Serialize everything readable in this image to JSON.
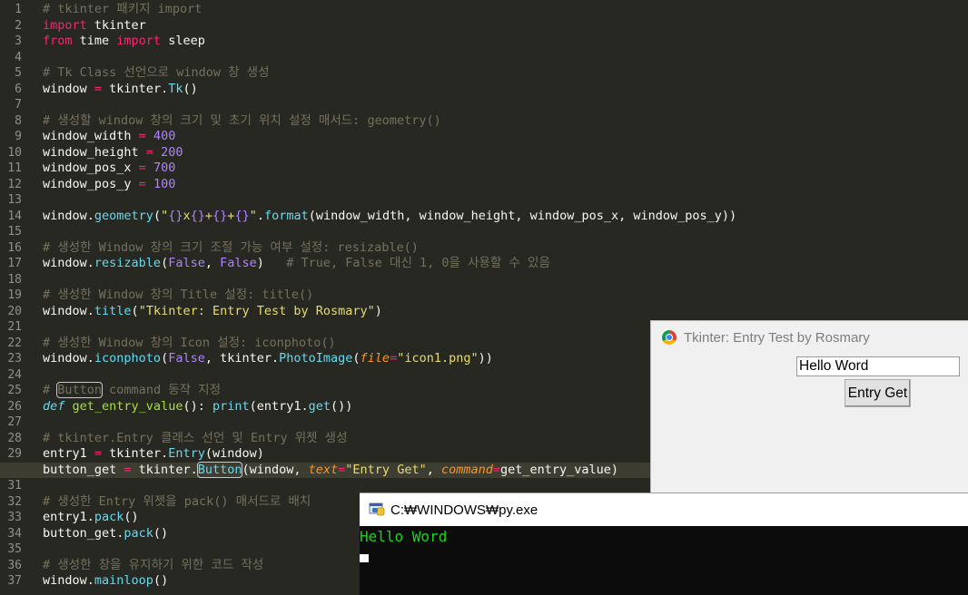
{
  "editor": {
    "line_numbers": [
      "1",
      "2",
      "3",
      "4",
      "5",
      "6",
      "7",
      "8",
      "9",
      "10",
      "11",
      "12",
      "13",
      "14",
      "15",
      "16",
      "17",
      "18",
      "19",
      "20",
      "21",
      "22",
      "23",
      "24",
      "25",
      "26",
      "27",
      "28",
      "29",
      "30",
      "31",
      "32",
      "33",
      "34",
      "35",
      "36",
      "37"
    ],
    "current_line": 30,
    "lines": [
      [
        [
          "c",
          "# tkinter 패키지 import"
        ]
      ],
      [
        [
          "k",
          "import"
        ],
        [
          "t",
          " tkinter"
        ]
      ],
      [
        [
          "k",
          "from"
        ],
        [
          "t",
          " time "
        ],
        [
          "k",
          "import"
        ],
        [
          "t",
          " sleep"
        ]
      ],
      [],
      [
        [
          "c",
          "# Tk Class 선언으로 window 창 생성"
        ]
      ],
      [
        [
          "t",
          "window "
        ],
        [
          "o",
          "="
        ],
        [
          "t",
          " tkinter."
        ],
        [
          "f",
          "Tk"
        ],
        [
          "t",
          "()"
        ]
      ],
      [],
      [
        [
          "c",
          "# 생성할 window 창의 크기 및 초기 위치 설정 매서드: geometry()"
        ]
      ],
      [
        [
          "t",
          "window_width "
        ],
        [
          "o",
          "="
        ],
        [
          "t",
          " "
        ],
        [
          "n",
          "400"
        ]
      ],
      [
        [
          "t",
          "window_height "
        ],
        [
          "o",
          "="
        ],
        [
          "t",
          " "
        ],
        [
          "n",
          "200"
        ]
      ],
      [
        [
          "t",
          "window_pos_x "
        ],
        [
          "o",
          "="
        ],
        [
          "t",
          " "
        ],
        [
          "n",
          "700"
        ]
      ],
      [
        [
          "t",
          "window_pos_y "
        ],
        [
          "o",
          "="
        ],
        [
          "t",
          " "
        ],
        [
          "n",
          "100"
        ]
      ],
      [],
      [
        [
          "t",
          "window."
        ],
        [
          "f",
          "geometry"
        ],
        [
          "t",
          "("
        ],
        [
          "s",
          "\""
        ],
        [
          "n",
          "{}"
        ],
        [
          "s",
          "x"
        ],
        [
          "n",
          "{}"
        ],
        [
          "s",
          "+"
        ],
        [
          "n",
          "{}"
        ],
        [
          "s",
          "+"
        ],
        [
          "n",
          "{}"
        ],
        [
          "s",
          "\""
        ],
        [
          "t",
          "."
        ],
        [
          "f",
          "format"
        ],
        [
          "t",
          "(window_width, window_height, window_pos_x, window_pos_y))"
        ]
      ],
      [],
      [
        [
          "c",
          "# 생성한 Window 창의 크기 조절 가능 여부 설정: resizable()"
        ]
      ],
      [
        [
          "t",
          "window."
        ],
        [
          "f",
          "resizable"
        ],
        [
          "t",
          "("
        ],
        [
          "n",
          "False"
        ],
        [
          "t",
          ", "
        ],
        [
          "n",
          "False"
        ],
        [
          "t",
          ")   "
        ],
        [
          "c",
          "# True, False 대신 1, 0을 사용할 수 있음"
        ]
      ],
      [],
      [
        [
          "c",
          "# 생성한 Window 창의 Title 설정: title()"
        ]
      ],
      [
        [
          "t",
          "window."
        ],
        [
          "f",
          "title"
        ],
        [
          "t",
          "("
        ],
        [
          "s",
          "\"Tkinter: Entry Test by Rosmary\""
        ],
        [
          "t",
          ")"
        ]
      ],
      [],
      [
        [
          "c",
          "# 생성한 Window 창의 Icon 설정: iconphoto()"
        ]
      ],
      [
        [
          "t",
          "window."
        ],
        [
          "f",
          "iconphoto"
        ],
        [
          "t",
          "("
        ],
        [
          "n",
          "False"
        ],
        [
          "t",
          ", tkinter."
        ],
        [
          "f",
          "PhotoImage"
        ],
        [
          "t",
          "("
        ],
        [
          "p",
          "file"
        ],
        [
          "o",
          "="
        ],
        [
          "s",
          "\"icon1.png\""
        ],
        [
          "t",
          "))"
        ]
      ],
      [],
      [
        [
          "c",
          "# "
        ],
        [
          "cb",
          "Button"
        ],
        [
          "c",
          " command 동작 지정"
        ]
      ],
      [
        [
          "d",
          "def"
        ],
        [
          "t",
          " "
        ],
        [
          "g",
          "get_entry_value"
        ],
        [
          "t",
          "(): "
        ],
        [
          "f",
          "print"
        ],
        [
          "t",
          "(entry1."
        ],
        [
          "f",
          "get"
        ],
        [
          "t",
          "())"
        ]
      ],
      [],
      [
        [
          "c",
          "# tkinter.Entry 클래스 선언 및 Entry 위젯 생성"
        ]
      ],
      [
        [
          "t",
          "entry1 "
        ],
        [
          "o",
          "="
        ],
        [
          "t",
          " tkinter."
        ],
        [
          "f",
          "Entry"
        ],
        [
          "t",
          "(window)"
        ]
      ],
      [
        [
          "t",
          "button_get "
        ],
        [
          "o",
          "="
        ],
        [
          "t",
          " tkinter."
        ],
        [
          "fb",
          "Button"
        ],
        [
          "t",
          "(window, "
        ],
        [
          "p",
          "text"
        ],
        [
          "o",
          "="
        ],
        [
          "s",
          "\"Entry Get\""
        ],
        [
          "t",
          ", "
        ],
        [
          "p",
          "command"
        ],
        [
          "o",
          "="
        ],
        [
          "t",
          "get_entry_value)"
        ]
      ],
      [],
      [
        [
          "c",
          "# 생성한 Entry 위젯을 pack() 매서드로 배치"
        ]
      ],
      [
        [
          "t",
          "entry1."
        ],
        [
          "f",
          "pack"
        ],
        [
          "t",
          "()"
        ]
      ],
      [
        [
          "t",
          "button_get."
        ],
        [
          "f",
          "pack"
        ],
        [
          "t",
          "()"
        ]
      ],
      [],
      [
        [
          "c",
          "# 생성한 창을 유지하기 위한 코드 작성"
        ]
      ],
      [
        [
          "t",
          "window."
        ],
        [
          "f",
          "mainloop"
        ],
        [
          "t",
          "()"
        ]
      ]
    ]
  },
  "tk_window": {
    "title": "Tkinter: Entry Test by Rosmary",
    "icon": "chrome-icon",
    "entry_value": "Hello Word",
    "button_label": "Entry Get",
    "overflow_glyph": "-"
  },
  "console_window": {
    "title": "C:₩WINDOWS₩py.exe",
    "icon": "python-console-icon",
    "output": "Hello Word"
  }
}
